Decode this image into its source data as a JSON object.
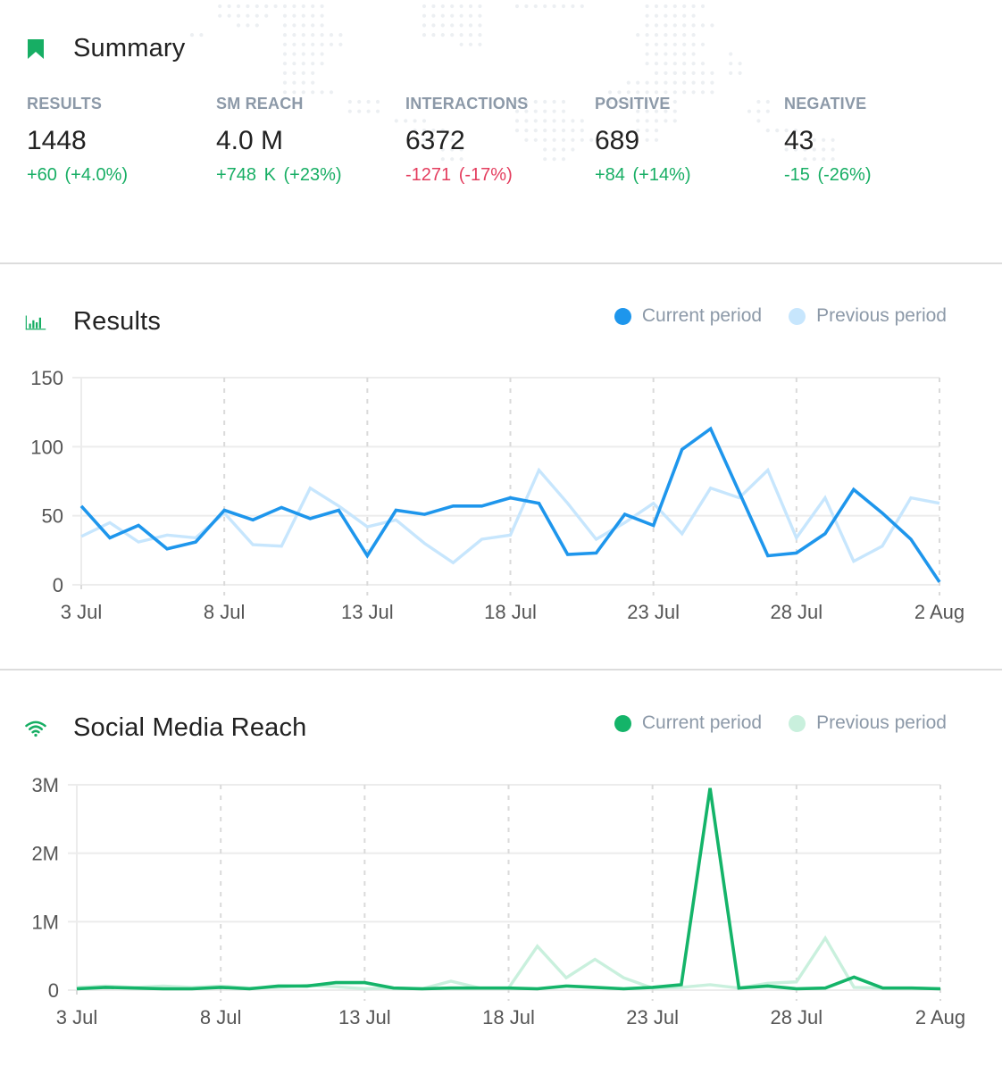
{
  "summary": {
    "title": "Summary",
    "icon": "bookmark-icon",
    "stats": [
      {
        "label": "RESULTS",
        "value": "1448",
        "change": "+60",
        "change_pct": "(+4.0%)",
        "trend": "positive"
      },
      {
        "label": "SM REACH",
        "value": "4.0 M",
        "change": "+748 K",
        "change_pct": "(+23%)",
        "trend": "positive"
      },
      {
        "label": "INTERACTIONS",
        "value": "6372",
        "change": "-1271",
        "change_pct": "(-17%)",
        "trend": "negative"
      },
      {
        "label": "POSITIVE",
        "value": "689",
        "change": "+84",
        "change_pct": "(+14%)",
        "trend": "positive"
      },
      {
        "label": "NEGATIVE",
        "value": "43",
        "change": "-15",
        "change_pct": "(-26%)",
        "trend": "positive"
      }
    ]
  },
  "colors": {
    "green": "#17ae64",
    "red": "#e43d5e",
    "blue_current": "#1e96ec",
    "blue_previous": "#c7e6fd",
    "green_current": "#14b469",
    "green_previous": "#c9f0dd",
    "label_gray": "#8c99a8"
  },
  "chart_data": [
    {
      "type": "line",
      "title": "Results",
      "icon": "bar-chart-icon",
      "xlabel": "",
      "ylabel": "",
      "ylim": [
        0,
        150
      ],
      "yticks": [
        0,
        50,
        100,
        150
      ],
      "ytick_labels": [
        "0",
        "50",
        "100",
        "150"
      ],
      "xtick_labels": [
        "3 Jul",
        "8 Jul",
        "13 Jul",
        "18 Jul",
        "23 Jul",
        "28 Jul",
        "2 Aug"
      ],
      "xtick_index": [
        0,
        5,
        10,
        15,
        20,
        25,
        30
      ],
      "grid": true,
      "legend": {
        "placement": "top-right",
        "entries": [
          "Current period",
          "Previous period"
        ]
      },
      "x": [
        "3 Jul",
        "4 Jul",
        "5 Jul",
        "6 Jul",
        "7 Jul",
        "8 Jul",
        "9 Jul",
        "10 Jul",
        "11 Jul",
        "12 Jul",
        "13 Jul",
        "14 Jul",
        "15 Jul",
        "16 Jul",
        "17 Jul",
        "18 Jul",
        "19 Jul",
        "20 Jul",
        "21 Jul",
        "22 Jul",
        "23 Jul",
        "24 Jul",
        "25 Jul",
        "26 Jul",
        "27 Jul",
        "28 Jul",
        "29 Jul",
        "30 Jul",
        "31 Jul",
        "1 Aug",
        "2 Aug"
      ],
      "series": [
        {
          "name": "Current period",
          "color": "#1e96ec",
          "values": [
            57,
            34,
            43,
            26,
            31,
            54,
            47,
            56,
            48,
            54,
            21,
            54,
            51,
            57,
            57,
            63,
            59,
            22,
            23,
            51,
            43,
            98,
            113,
            67,
            21,
            23,
            37,
            69,
            52,
            33,
            2
          ]
        },
        {
          "name": "Previous period",
          "color": "#c7e6fd",
          "values": [
            35,
            45,
            31,
            36,
            34,
            52,
            29,
            28,
            70,
            57,
            42,
            47,
            30,
            16,
            33,
            36,
            83,
            59,
            33,
            45,
            59,
            37,
            70,
            63,
            83,
            34,
            63,
            17,
            28,
            63,
            59
          ]
        }
      ]
    },
    {
      "type": "line",
      "title": "Social Media Reach",
      "icon": "wifi-icon",
      "xlabel": "",
      "ylabel": "",
      "ylim": [
        0,
        3000000
      ],
      "yticks": [
        0,
        1000000,
        2000000,
        3000000
      ],
      "ytick_labels": [
        "0",
        "1M",
        "2M",
        "3M"
      ],
      "xtick_labels": [
        "3 Jul",
        "8 Jul",
        "13 Jul",
        "18 Jul",
        "23 Jul",
        "28 Jul",
        "2 Aug"
      ],
      "xtick_index": [
        0,
        5,
        10,
        15,
        20,
        25,
        30
      ],
      "grid": true,
      "legend": {
        "placement": "top-right",
        "entries": [
          "Current period",
          "Previous period"
        ]
      },
      "x": [
        "3 Jul",
        "4 Jul",
        "5 Jul",
        "6 Jul",
        "7 Jul",
        "8 Jul",
        "9 Jul",
        "10 Jul",
        "11 Jul",
        "12 Jul",
        "13 Jul",
        "14 Jul",
        "15 Jul",
        "16 Jul",
        "17 Jul",
        "18 Jul",
        "19 Jul",
        "20 Jul",
        "21 Jul",
        "22 Jul",
        "23 Jul",
        "24 Jul",
        "25 Jul",
        "26 Jul",
        "27 Jul",
        "28 Jul",
        "29 Jul",
        "30 Jul",
        "31 Jul",
        "1 Aug",
        "2 Aug"
      ],
      "series": [
        {
          "name": "Current period",
          "color": "#14b469",
          "values": [
            20000,
            40000,
            30000,
            20000,
            20000,
            40000,
            20000,
            60000,
            60000,
            110000,
            110000,
            30000,
            20000,
            30000,
            30000,
            30000,
            20000,
            60000,
            40000,
            20000,
            40000,
            80000,
            2950000,
            30000,
            60000,
            20000,
            30000,
            190000,
            30000,
            30000,
            20000
          ]
        },
        {
          "name": "Previous period",
          "color": "#c9f0dd",
          "values": [
            40000,
            60000,
            40000,
            60000,
            40000,
            60000,
            30000,
            40000,
            70000,
            50000,
            20000,
            30000,
            20000,
            130000,
            30000,
            30000,
            640000,
            180000,
            450000,
            180000,
            30000,
            40000,
            80000,
            30000,
            100000,
            120000,
            760000,
            40000,
            30000,
            30000,
            20000
          ]
        }
      ]
    }
  ]
}
